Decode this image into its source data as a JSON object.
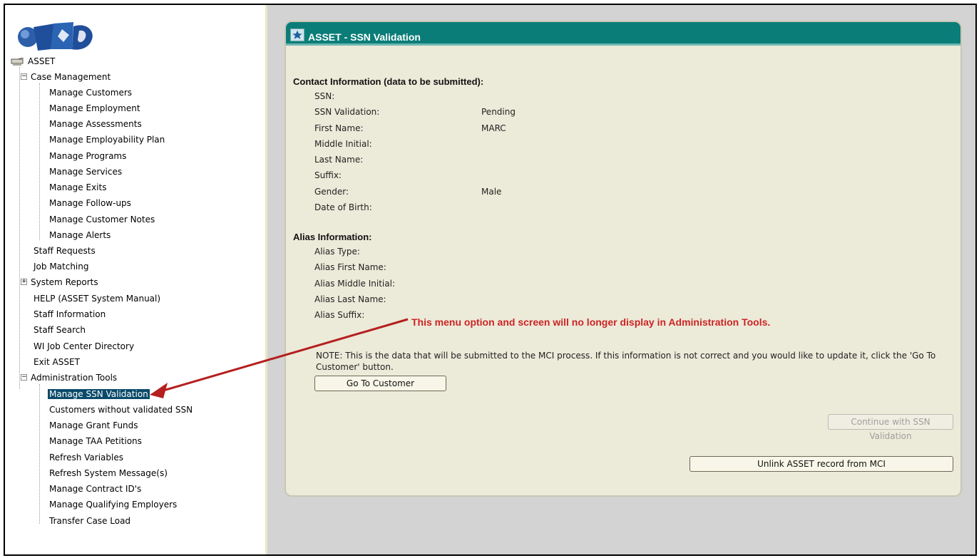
{
  "app": {
    "brand": "ASSET logo"
  },
  "tree": {
    "root": "ASSET",
    "case_management": "Case Management",
    "case_items": [
      "Manage Customers",
      "Manage Employment",
      "Manage Assessments",
      "Manage Employability Plan",
      "Manage Programs",
      "Manage Services",
      "Manage Exits",
      "Manage Follow-ups",
      "Manage Customer Notes",
      "Manage Alerts"
    ],
    "top_items": {
      "staff_requests": "Staff Requests",
      "job_matching": "Job Matching",
      "system_reports": "System Reports",
      "help": "HELP (ASSET System Manual)",
      "staff_information": "Staff Information",
      "staff_search": "Staff Search",
      "directory": "WI Job Center Directory",
      "exit": "Exit ASSET"
    },
    "admin_tools": "Administration Tools",
    "admin_items": [
      "Manage SSN Validation",
      "Customers without validated SSN",
      "Manage Grant Funds",
      "Manage TAA Petitions",
      "Refresh Variables",
      "Refresh System Message(s)",
      "Manage Contract ID's",
      "Manage Qualifying Employers",
      "Transfer Case Load"
    ],
    "selected": "Manage SSN Validation"
  },
  "panel": {
    "title": "ASSET - SSN Validation",
    "contact_header": "Contact Information (data to be submitted):",
    "contact": [
      {
        "label": "SSN:",
        "value": ""
      },
      {
        "label": "SSN Validation:",
        "value": "Pending"
      },
      {
        "label": "First Name:",
        "value": "MARC"
      },
      {
        "label": "Middle Initial:",
        "value": ""
      },
      {
        "label": "Last Name:",
        "value": ""
      },
      {
        "label": "Suffix:",
        "value": ""
      },
      {
        "label": "Gender:",
        "value": "Male"
      },
      {
        "label": "Date of Birth:",
        "value": ""
      }
    ],
    "alias_header": "Alias Information:",
    "alias": [
      {
        "label": "Alias Type:",
        "value": ""
      },
      {
        "label": "Alias First Name:",
        "value": ""
      },
      {
        "label": "Alias Middle Initial:",
        "value": ""
      },
      {
        "label": "Alias Last Name:",
        "value": ""
      },
      {
        "label": "Alias Suffix:",
        "value": ""
      }
    ],
    "note": "NOTE: This is the data that will be submitted to the MCI process. If this information is not correct and you would like to update it, click the 'Go To Customer' button.",
    "go_to_customer": "Go To Customer",
    "continue_label": "Continue with SSN Validation",
    "unlink_label": "Unlink ASSET record from MCI"
  },
  "annotation": {
    "callout": "This menu option and screen will no longer display in Administration Tools.",
    "color": "#cc2424"
  },
  "colors": {
    "header_teal": "#0b7d78",
    "panel_bg": "#ecead9",
    "selection": "#0a4a6a"
  }
}
